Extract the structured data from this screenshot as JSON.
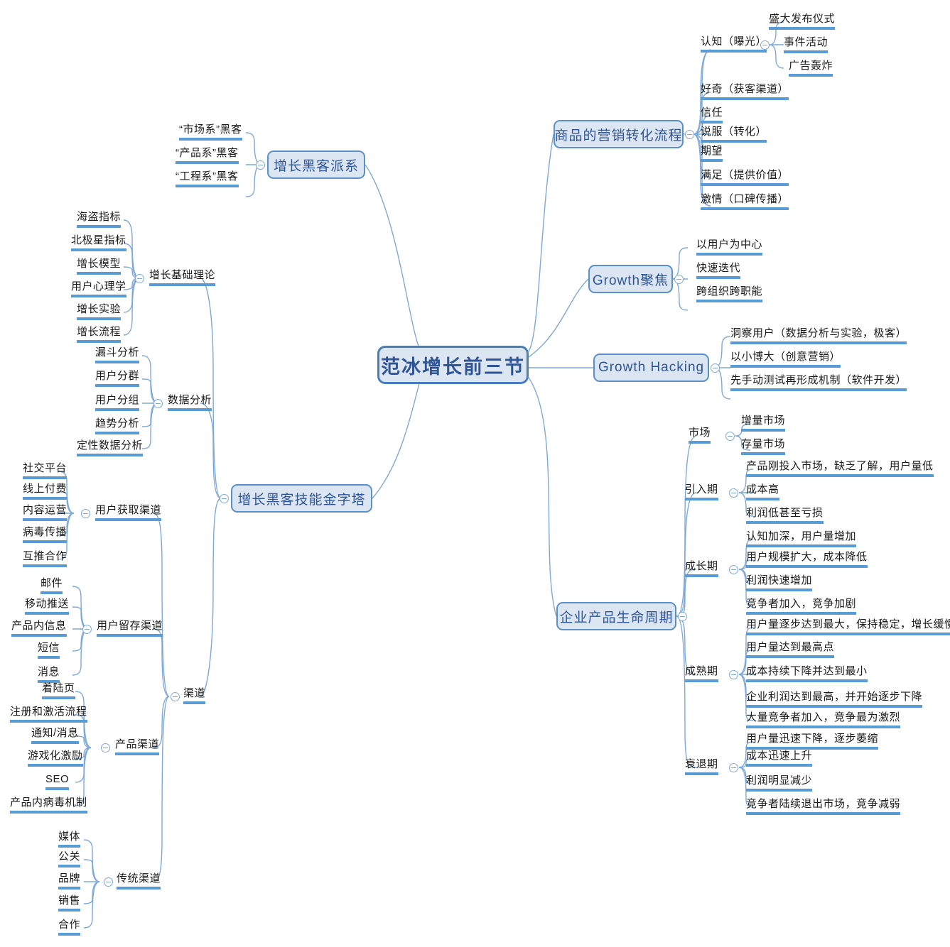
{
  "colors": {
    "node_fill": "#dce6f2",
    "node_border": "#5b8fc9",
    "node_text": "#2f5597",
    "underline": "#5b9bd5",
    "link": "#7fa9d6",
    "leaf_text": "#1a1a1a"
  },
  "root": {
    "label": "范冰增长前三节"
  },
  "branches": {
    "marketing_funnel": {
      "label": "商品的营销转化流程",
      "children": [
        {
          "label": "认知（曝光）",
          "children": [
            "盛大发布仪式",
            "事件活动",
            "广告轰炸"
          ]
        },
        {
          "label": "好奇（获客渠道）"
        },
        {
          "label": "信任"
        },
        {
          "label": "说服（转化）"
        },
        {
          "label": "期望"
        },
        {
          "label": "满足（提供价值）"
        },
        {
          "label": "激情（口碑传播）"
        }
      ]
    },
    "growth_focus": {
      "label": "Growth聚焦",
      "children": [
        "以用户为中心",
        "快速迭代",
        "跨组织跨职能"
      ]
    },
    "growth_hacking": {
      "label": "Growth  Hacking",
      "children": [
        "洞察用户（数据分析与实验，极客）",
        "以小博大（创意营销）",
        "先手动测试再形成机制（软件开发）"
      ]
    },
    "product_lifecycle": {
      "label": "企业产品生命周期",
      "children": [
        {
          "label": "市场",
          "children": [
            "增量市场",
            "存量市场"
          ]
        },
        {
          "label": "引入期",
          "children": [
            "产品刚投入市场，缺乏了解，用户量低",
            "成本高",
            "利润低甚至亏损"
          ]
        },
        {
          "label": "成长期",
          "children": [
            "认知加深，用户量增加",
            "用户规模扩大，成本降低",
            "利润快速增加",
            "竞争者加入，竞争加剧"
          ]
        },
        {
          "label": "成熟期",
          "children": [
            "用户量逐步达到最大，保持稳定，增长缓慢",
            "用户量达到最高点",
            "成本持续下降并达到最小",
            "企业利润达到最高，并开始逐步下降",
            "大量竞争者加入，竞争最为激烈"
          ]
        },
        {
          "label": "衰退期",
          "children": [
            "用户量迅速下降，逐步萎缩",
            "成本迅速上升",
            "利润明显减少",
            "竞争者陆续退出市场，竞争减弱"
          ]
        }
      ]
    },
    "hacker_schools": {
      "label": "增长黑客派系",
      "children": [
        "“市场系”黑客",
        "“产品系”黑客",
        "“工程系”黑客"
      ]
    },
    "skill_pyramid": {
      "label": "增长黑客技能金字塔",
      "children": [
        {
          "label": "增长基础理论",
          "children": [
            "海盗指标",
            "北极星指标",
            "增长模型",
            "用户心理学",
            "增长实验",
            "增长流程"
          ]
        },
        {
          "label": "数据分析",
          "children": [
            "漏斗分析",
            "用户分群",
            "用户分组",
            "趋势分析",
            "定性数据分析"
          ]
        },
        {
          "label": "渠道",
          "children": [
            {
              "label": "用户获取渠道",
              "children": [
                "社交平台",
                "线上付费",
                "内容运营",
                "病毒传播",
                "互推合作"
              ]
            },
            {
              "label": "用户留存渠道",
              "children": [
                "邮件",
                "移动推送",
                "产品内信息",
                "短信",
                "消息"
              ]
            },
            {
              "label": "产品渠道",
              "children": [
                "着陆页",
                "注册和激活流程",
                "通知/消息",
                "游戏化激励",
                "SEO",
                "产品内病毒机制"
              ]
            },
            {
              "label": "传统渠道",
              "children": [
                "媒体",
                "公关",
                "品牌",
                "销售",
                "合作"
              ]
            }
          ]
        }
      ]
    }
  }
}
